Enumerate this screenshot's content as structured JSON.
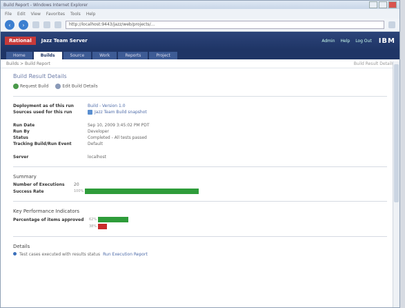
{
  "window": {
    "title": "Build Report - Windows Internet Explorer"
  },
  "browser": {
    "menu": [
      "File",
      "Edit",
      "View",
      "Favorites",
      "Tools",
      "Help"
    ],
    "address": "http://localhost:9443/jazz/web/projects/..."
  },
  "app": {
    "product_badge": "Rational",
    "title": "Jazz Team Server",
    "header_links": [
      "Admin",
      "Help",
      "Log Out"
    ],
    "ibm_logo": "IBM",
    "tabs": [
      {
        "label": "Home"
      },
      {
        "label": "Builds",
        "active": true
      },
      {
        "label": "Source"
      },
      {
        "label": "Work"
      },
      {
        "label": "Reports"
      },
      {
        "label": "Project"
      }
    ],
    "breadcrumb": "Builds > Build Report",
    "breadcrumb_right": "Build Result Details"
  },
  "page": {
    "title": "Build Result Details",
    "actions": [
      "Request Build",
      "Edit Build Details"
    ]
  },
  "details": {
    "deployment_label": "Deployment as of this run",
    "deployment_value": "Build - Version 1.0",
    "sources_label": "Sources used for this run",
    "sources_value": "Jazz Team Build snapshot",
    "rows": [
      {
        "k": "Run Date",
        "v": "Sep 10, 2009 3:45:02 PM PDT"
      },
      {
        "k": "Run By",
        "v": "Developer"
      },
      {
        "k": "Status",
        "v": "Completed - All tests passed"
      },
      {
        "k": "Tracking Build/Run Event",
        "v": "Default"
      }
    ],
    "server_label": "Server",
    "server_value": "localhost"
  },
  "summary": {
    "heading": "Summary",
    "executions_label": "Number of Executions",
    "executions_value": "20",
    "success_label": "Success Rate",
    "success_pct": "100%",
    "success_fraction": 1.0
  },
  "kpi": {
    "heading": "Key Performance Indicators",
    "approved_label": "Percentage of items approved",
    "approved_pct": "62%",
    "approved_fraction": 0.62,
    "rejected_pct": "38%",
    "rejected_fraction": 0.38
  },
  "details_section": {
    "heading": "Details",
    "item": "Test cases executed with results status",
    "link": "Run Execution Report"
  },
  "colors": {
    "accent": "#1f3566",
    "success": "#2e9c3a",
    "failure": "#c92c2c"
  }
}
